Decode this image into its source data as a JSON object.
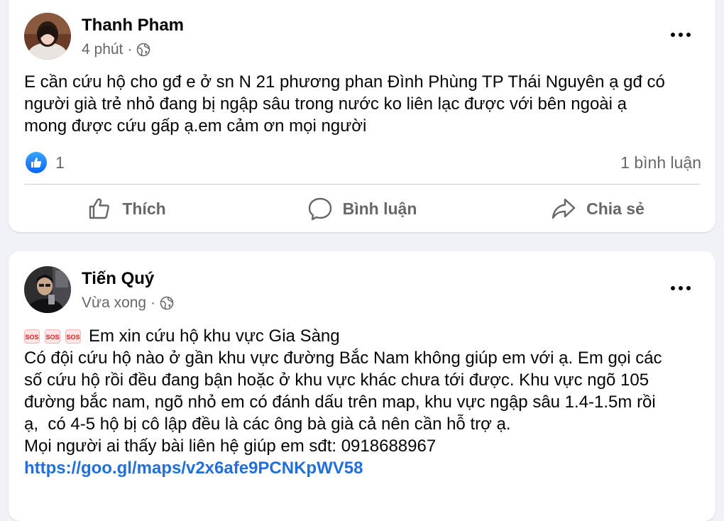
{
  "posts": [
    {
      "author": "Thanh Pham",
      "time": "4 phút",
      "separator": "·",
      "privacy_icon": "globe-icon",
      "more_icon": "more-options-icon",
      "body_lines": [
        "E cần cứu hộ cho gđ e ở sn N 21 phương phan Đình Phùng TP Thái Nguyên ạ gđ có",
        "người già trẻ nhỏ đang bị ngập sâu trong nước ko liên lạc được với bên ngoài ạ",
        "mong được cứu gấp ạ.em cảm ơn mọi người"
      ],
      "reaction_icon": "like-reaction-icon",
      "reaction_count": "1",
      "comment_count": "1 bình luận",
      "actions": {
        "like": "Thích",
        "comment": "Bình luận",
        "share": "Chia sẻ"
      }
    },
    {
      "author": "Tiến Quý",
      "time": "Vừa xong",
      "separator": "·",
      "privacy_icon": "globe-icon",
      "more_icon": "more-options-icon",
      "sos_emoji": [
        "SOS",
        "SOS",
        "SOS"
      ],
      "headline": "Em xin cứu hộ khu vực Gia Sàng",
      "body_lines": [
        "Có đội cứu hộ nào ở gần khu vực đường Bắc Nam không giúp em với ạ. Em gọi các",
        "số cứu hộ rồi đều đang bận hoặc ở khu vực khác chưa tới được. Khu vực ngõ 105",
        "đường bắc nam, ngõ nhỏ em có đánh dấu trên map, khu vực ngập sâu 1.4-1.5m rồi",
        "ạ,  có 4-5 hộ bị cô lập đều là các ông bà già cả nên cần hỗ trợ ạ.",
        "Mọi người ai thấy bài liên hệ giúp em sđt: 0918688967"
      ],
      "link": "https://goo.gl/maps/v2x6afe9PCNKpWV58"
    }
  ],
  "colors": {
    "background": "#f0f2f5",
    "card": "#ffffff",
    "primary_text": "#050505",
    "secondary_text": "#65676b",
    "link": "#216fdb",
    "like_blue": "#0866ff"
  }
}
